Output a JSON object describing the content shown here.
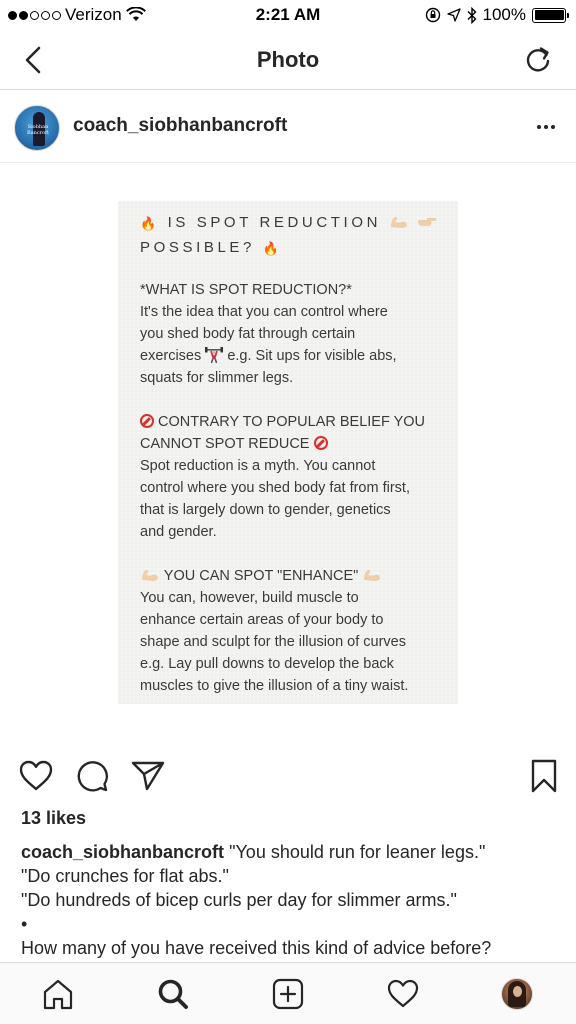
{
  "status_bar": {
    "carrier": "Verizon",
    "time": "2:21 AM",
    "battery": "100%"
  },
  "nav": {
    "title": "Photo"
  },
  "post": {
    "username": "coach_siobhanbancroft",
    "avatar_text": "Siobhan Bancroft"
  },
  "note": {
    "heading_line1": "IS SPOT REDUCTION",
    "heading_line2": "POSSIBLE?",
    "section1_title": "*WHAT IS SPOT REDUCTION?*",
    "section1_body1": "It's the idea that you can control where",
    "section1_body2": "you shed body fat through certain",
    "section1_body3a": "exercises",
    "section1_body3b": "e.g. Sit ups for visible abs,",
    "section1_body4": "squats for slimmer legs.",
    "section2_title1": "CONTRARY TO POPULAR BELIEF YOU",
    "section2_title2": "CANNOT SPOT REDUCE",
    "section2_body1": "Spot reduction is a myth. You cannot",
    "section2_body2": "control where you shed body fat from first,",
    "section2_body3": "that is largely down to gender, genetics",
    "section2_body4": "and gender.",
    "section3_title": "YOU CAN SPOT \"ENHANCE\"",
    "section3_body1": "You can, however, build muscle to",
    "section3_body2": "enhance certain areas of your body to",
    "section3_body3": "shape and sculpt for the illusion of curves",
    "section3_body4": "e.g. Lay pull downs to develop the back",
    "section3_body5": "muscles to give the illusion of a tiny waist."
  },
  "actions": {
    "like_icon": "heart-icon",
    "comment_icon": "comment-icon",
    "share_icon": "send-icon",
    "save_icon": "bookmark-icon"
  },
  "likes": "13 likes",
  "caption": {
    "username": "coach_siobhanbancroft",
    "line1": "\"You should run for leaner legs.\"",
    "line2": "\"Do crunches for flat abs.\"",
    "line3": "\"Do hundreds of bicep curls per day for slimmer arms.\"",
    "line4": "•",
    "line5": "How many of you have received this kind of advice before?"
  },
  "tab_bar": {
    "items": [
      "home-icon",
      "search-icon",
      "add-post-icon",
      "activity-heart-icon",
      "profile-avatar"
    ]
  },
  "colors": {
    "text": "#262626",
    "border": "#dbdbdb",
    "note_background": "#f3f3f1",
    "fire": "#e8541a",
    "no_entry": "#d9302c"
  }
}
